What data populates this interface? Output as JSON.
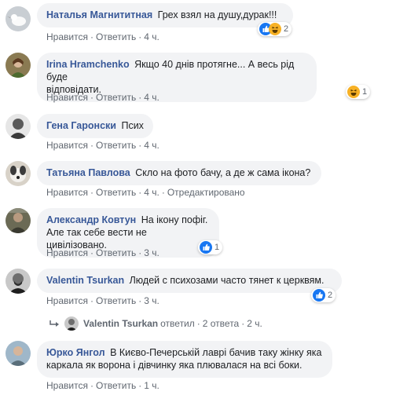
{
  "comments": [
    {
      "author": "Наталья Магнититная",
      "text": "Грех взял на душу,дурак!!!",
      "text2": "",
      "like": "Нравится",
      "reply": "Ответить",
      "time": "4 ч.",
      "extra": "",
      "reactions": [
        "like",
        "haha"
      ],
      "reaction_count": "2"
    },
    {
      "author": "Irina Hramchenko",
      "text": "Якщо 40 днів протягне... А весь рід буде",
      "text2": "відповідати.",
      "like": "Нравится",
      "reply": "Ответить",
      "time": "4 ч.",
      "extra": "",
      "reactions": [
        "haha"
      ],
      "reaction_count": "1"
    },
    {
      "author": "Гена Гаронски",
      "text": "Псих",
      "text2": "",
      "like": "Нравится",
      "reply": "Ответить",
      "time": "4 ч.",
      "extra": ""
    },
    {
      "author": "Татьяна Павлова",
      "text": "Скло на фото бачу, а де ж сама ікона?",
      "text2": "",
      "like": "Нравится",
      "reply": "Ответить",
      "time": "4 ч.",
      "extra": "Отредактировано"
    },
    {
      "author": "Александр Ковтун",
      "text": "На ікону пофіг.",
      "text2": "Але так себе вести не цивілізовано.",
      "like": "Нравится",
      "reply": "Ответить",
      "time": "3 ч.",
      "extra": "",
      "reactions": [
        "like"
      ],
      "reaction_count": "1"
    },
    {
      "author": "Valentin Tsurkan",
      "text": "Людей с психозами часто тянет к церквям.",
      "text2": "",
      "like": "Нравится",
      "reply": "Ответить",
      "time": "3 ч.",
      "extra": "",
      "reactions": [
        "like"
      ],
      "reaction_count": "2"
    },
    {
      "author": "Юрко Янгол",
      "text": "В Києво-Печерській лаврі бачив таку жінку яка",
      "text2": "каркала як ворона і дівчинку яка плювалася на всі боки.",
      "like": "Нравится",
      "reply": "Ответить",
      "time": "1 ч.",
      "extra": ""
    }
  ],
  "reply_summary": {
    "name": "Valentin Tsurkan",
    "action": "ответил",
    "replies": "2 ответа",
    "time": "2 ч."
  },
  "colors": {
    "author": "#385898",
    "bubble": "#f2f3f5",
    "meta": "#606770",
    "like": "#1877f2",
    "haha": "#f7b125"
  }
}
